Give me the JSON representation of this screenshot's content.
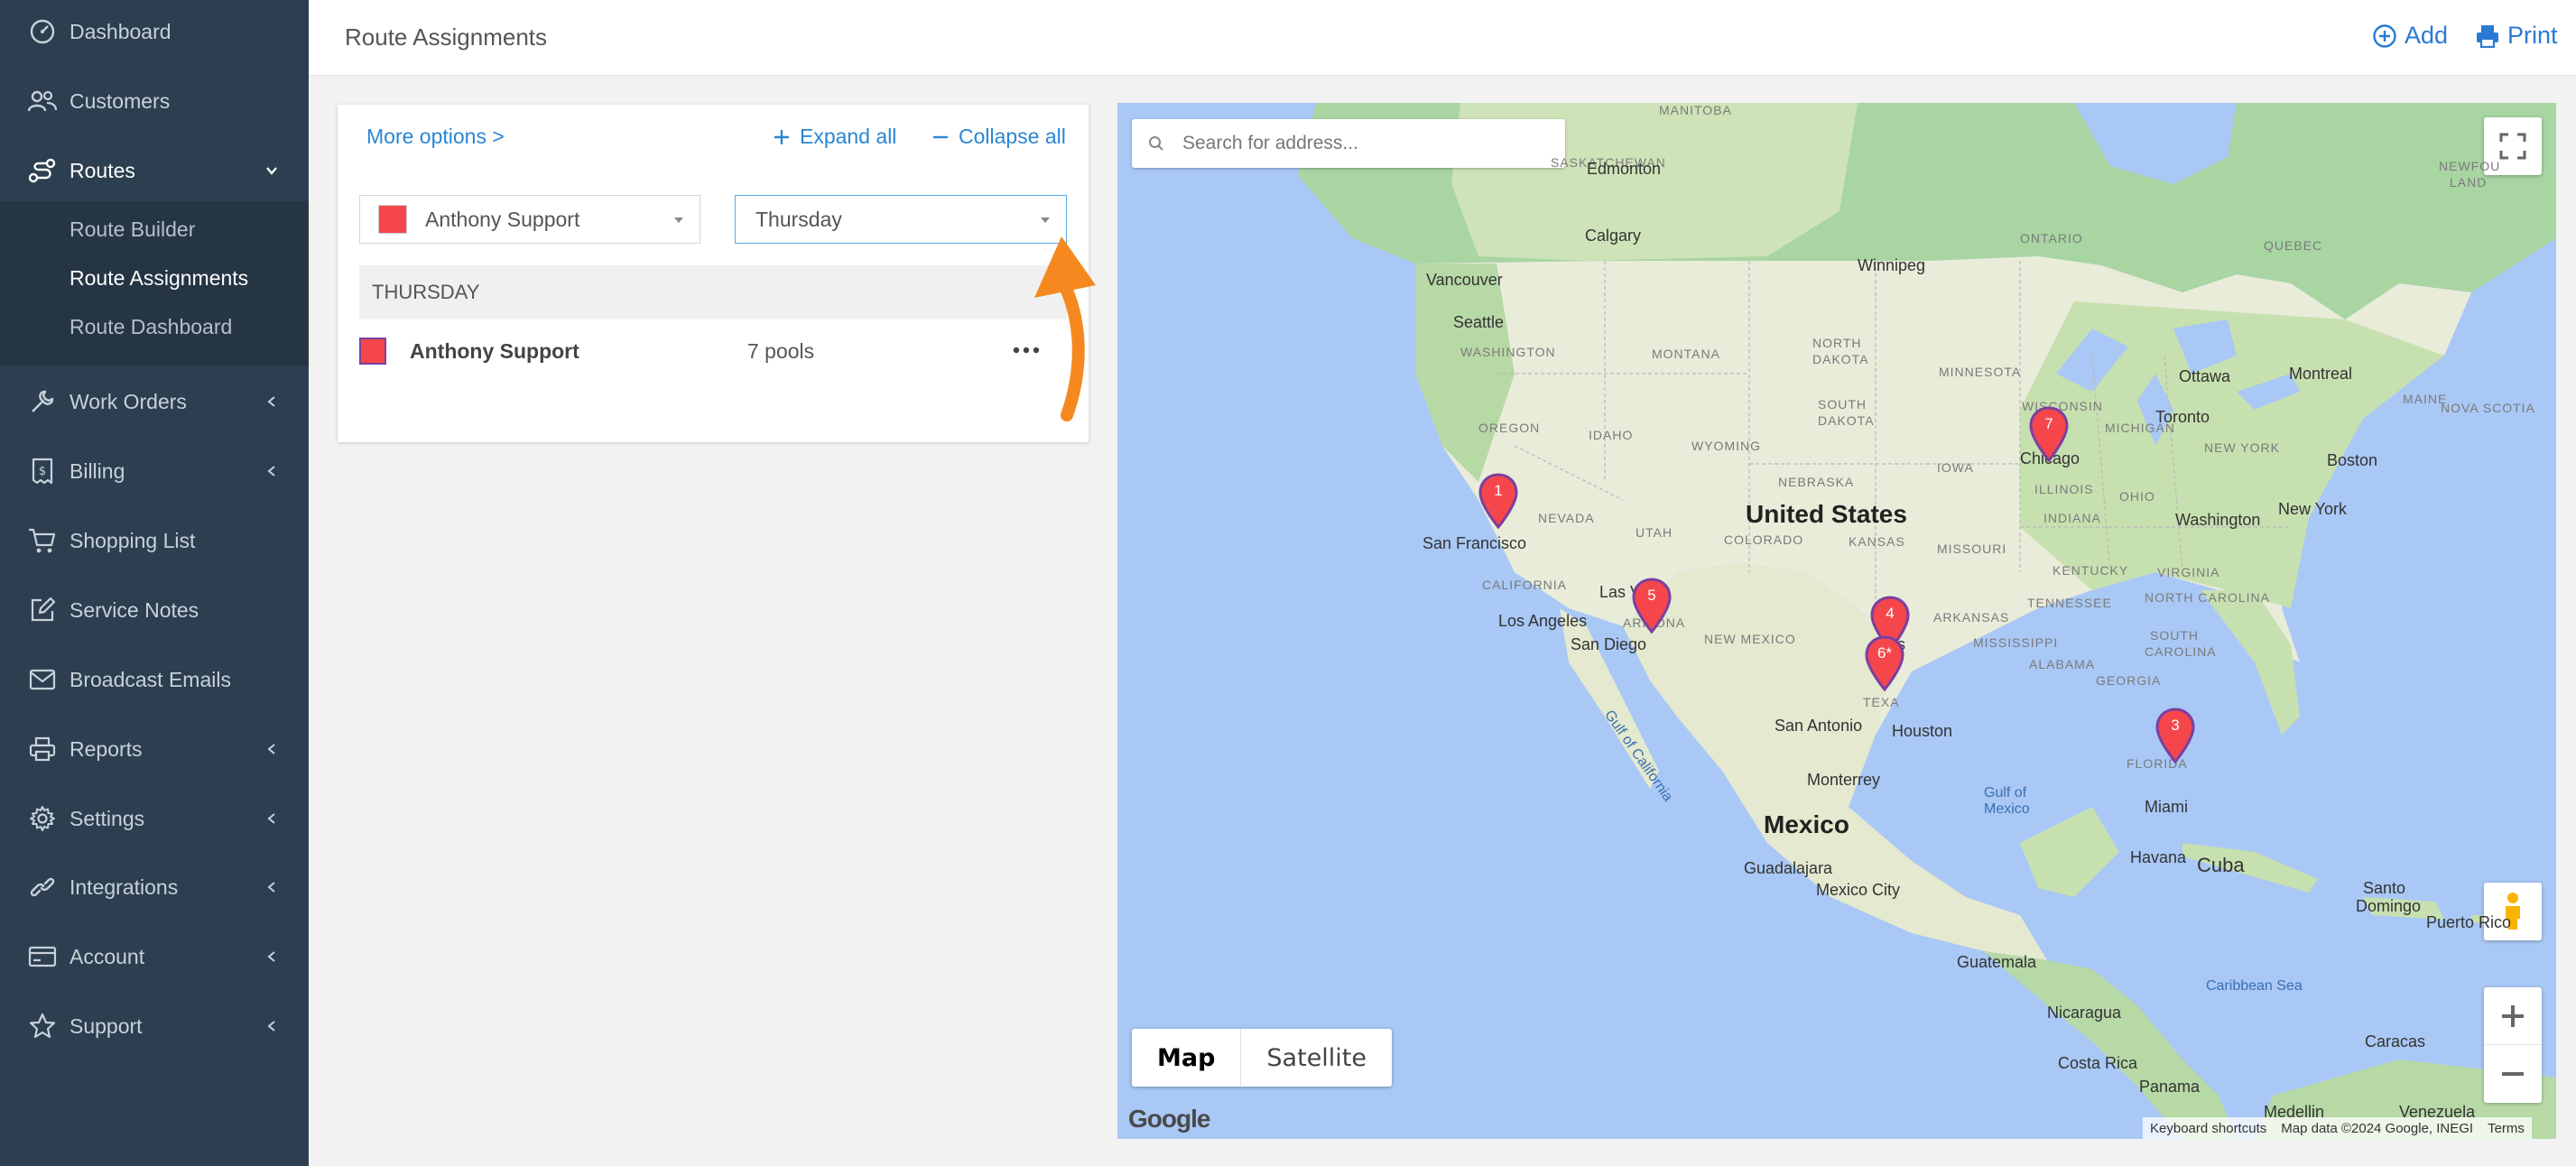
{
  "sidebar": {
    "items": [
      {
        "label": "Dashboard",
        "icon": "dashboard-icon"
      },
      {
        "label": "Customers",
        "icon": "users-icon"
      },
      {
        "label": "Routes",
        "icon": "route-icon"
      },
      {
        "label": "Work Orders",
        "icon": "wrench-icon"
      },
      {
        "label": "Billing",
        "icon": "billing-icon"
      },
      {
        "label": "Shopping List",
        "icon": "cart-icon"
      },
      {
        "label": "Service Notes",
        "icon": "edit-icon"
      },
      {
        "label": "Broadcast Emails",
        "icon": "mail-icon"
      },
      {
        "label": "Reports",
        "icon": "printer-icon"
      },
      {
        "label": "Settings",
        "icon": "gear-icon"
      },
      {
        "label": "Integrations",
        "icon": "link-icon"
      },
      {
        "label": "Account",
        "icon": "card-icon"
      },
      {
        "label": "Support",
        "icon": "star-icon"
      }
    ],
    "routes_sub": [
      "Route Builder",
      "Route Assignments",
      "Route Dashboard"
    ]
  },
  "header": {
    "title": "Route Assignments",
    "add_label": "Add",
    "print_label": "Print"
  },
  "panel": {
    "more_options": "More options >",
    "expand_all": "Expand all",
    "collapse_all": "Collapse all",
    "tech_select": "Anthony Support",
    "day_select": "Thursday",
    "day_header": "THURSDAY",
    "route_name": "Anthony Support",
    "route_count": "7 pools"
  },
  "map": {
    "search_placeholder": "Search for address...",
    "type_map": "Map",
    "type_satellite": "Satellite",
    "attribution": {
      "shortcuts": "Keyboard shortcuts",
      "data": "Map data ©2024 Google, INEGI",
      "terms": "Terms"
    },
    "google": "Google",
    "labels": {
      "manitoba": "MANITOBA",
      "saskatchewan": "SASKATCHEWAN",
      "edmonton": "Edmonton",
      "calgary": "Calgary",
      "ontario": "ONTARIO",
      "quebec": "QUEBEC",
      "newfou": "NEWFOU",
      "land": "LAND",
      "winnipeg": "Winnipeg",
      "vancouver": "Vancouver",
      "seattle": "Seattle",
      "washington_st": "WASHINGTON",
      "montana": "MONTANA",
      "north_dakota_1": "NORTH",
      "north_dakota_2": "DAKOTA",
      "minnesota": "MINNESOTA",
      "ottawa": "Ottawa",
      "montreal": "Montreal",
      "maine": "MAINE",
      "nova_scotia": "NOVA SCOTIA",
      "toronto": "Toronto",
      "wisconsin": "WISCONSIN",
      "michigan": "MICHIGAN",
      "new_york": "NEW YORK",
      "boston": "Boston",
      "south_dakota_1": "SOUTH",
      "south_dakota_2": "DAKOTA",
      "idaho": "IDAHO",
      "oregon": "OREGON",
      "wyoming": "WYOMING",
      "chicago": "Chicago",
      "iowa": "IOWA",
      "illinois": "ILLINOIS",
      "ohio": "OHIO",
      "indiana": "INDIANA",
      "washington_dc": "Washington",
      "new_york_city": "New York",
      "nebraska": "NEBRASKA",
      "nevada": "NEVADA",
      "united_states": "United States",
      "utah": "UTAH",
      "colorado": "COLORADO",
      "kansas": "KANSAS",
      "missouri": "MISSOURI",
      "san_francisco": "San Francisco",
      "kentucky": "KENTUCKY",
      "virginia": "VIRGINIA",
      "california": "CALIFORNIA",
      "las_vegas": "Las Ve",
      "tennessee": "TENNESSEE",
      "north_carolina": "NORTH CAROLINA",
      "los_angeles": "Los Angeles",
      "arizona": "ARIZONA",
      "new_mexico": "NEW MEXICO",
      "arkansas": "ARKANSAS",
      "south_carolina_1": "SOUTH",
      "south_carolina_2": "CAROLINA",
      "san_diego": "San Diego",
      "dallas": "las",
      "mississippi": "MISSISSIPPI",
      "alabama": "ALABAMA",
      "georgia": "GEORGIA",
      "texas": "TEXA",
      "san_antonio": "San Antonio",
      "houston": "Houston",
      "gulf_california": "Gulf of California",
      "florida": "FLORIDA",
      "gulf_mexico_1": "Gulf of",
      "gulf_mexico_2": "Mexico",
      "monterrey": "Monterrey",
      "miami": "Miami",
      "mexico": "Mexico",
      "havana": "Havana",
      "cuba": "Cuba",
      "guadalajara": "Guadalajara",
      "mexico_city": "Mexico City",
      "santo_domingo_1": "Santo",
      "santo_domingo_2": "Domingo",
      "puerto_rico": "Puerto Rico",
      "guatemala": "Guatemala",
      "caribbean": "Caribbean Sea",
      "nicaragua": "Nicaragua",
      "caracas": "Caracas",
      "costa_rica": "Costa Rica",
      "panama": "Panama",
      "medellin": "Medellin",
      "venezuela": "Venezuela"
    },
    "pins": [
      {
        "label": "1",
        "color": "#f5474b"
      },
      {
        "label": "5",
        "color": "#f5474b"
      },
      {
        "label": "4",
        "color": "#f5474b"
      },
      {
        "label": "6*",
        "color": "#f5474b"
      },
      {
        "label": "7",
        "color": "#f5474b"
      },
      {
        "label": "3",
        "color": "#f5474b"
      }
    ]
  },
  "colors": {
    "sidebar_bg": "#2c3e50",
    "accent": "#2a86d4",
    "route_color": "#f5474b",
    "annotation_arrow": "#f5891f"
  }
}
